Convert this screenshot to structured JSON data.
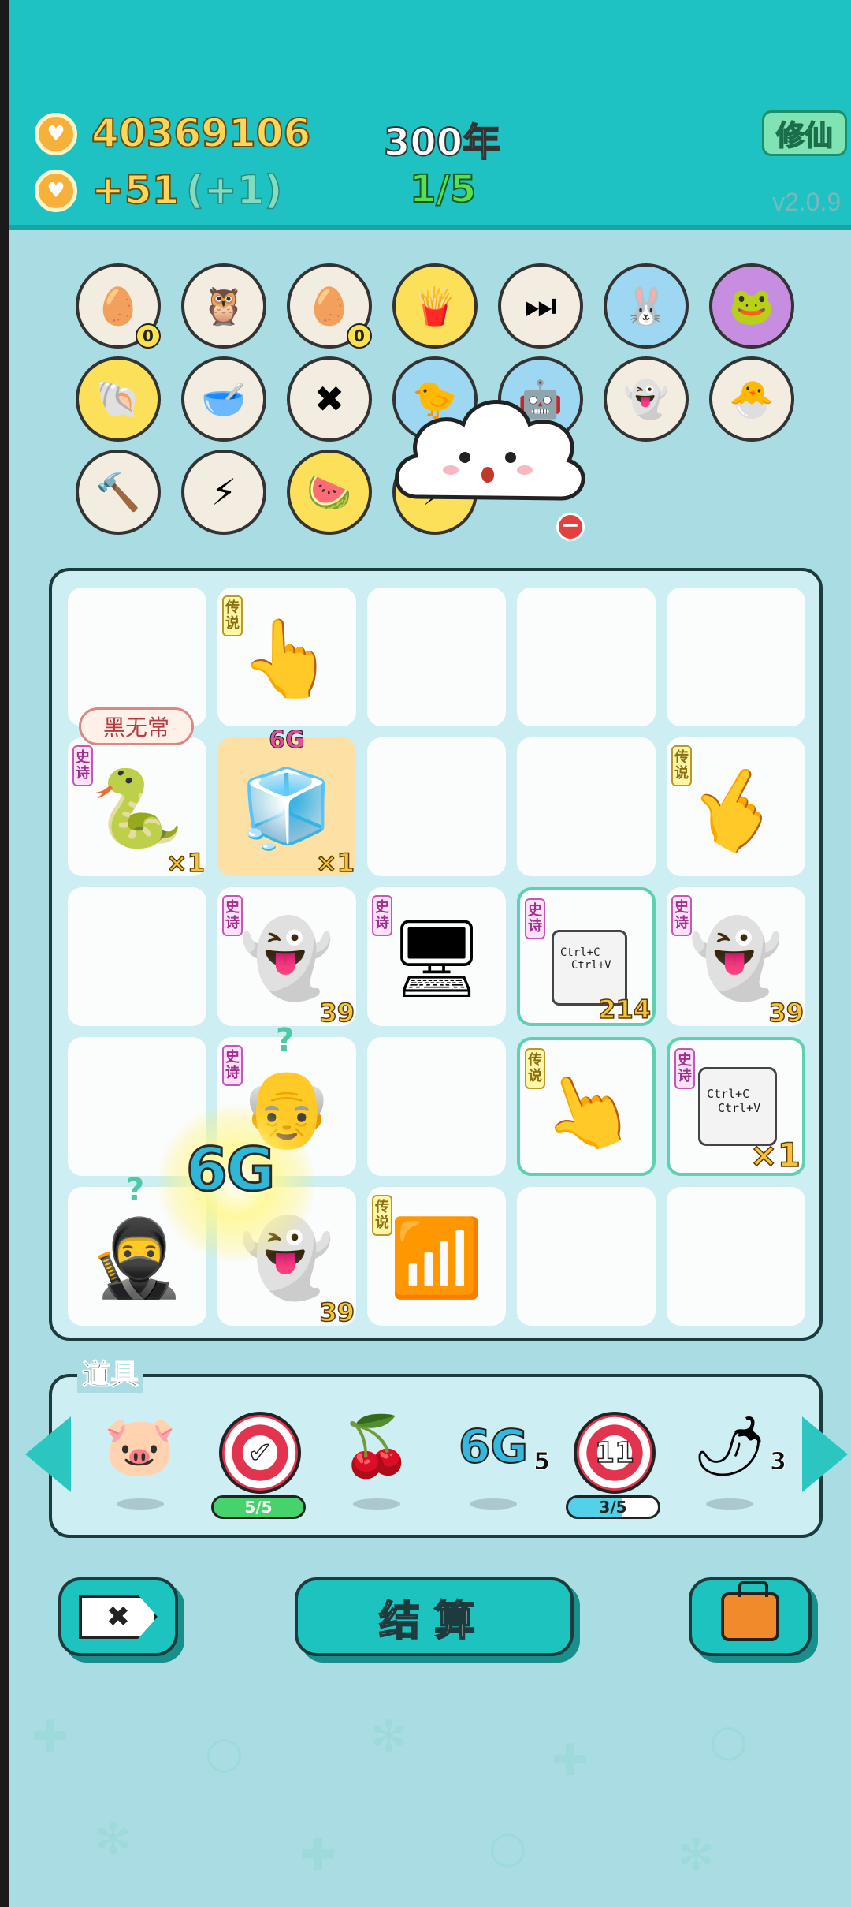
{
  "header": {
    "coins": "40369106",
    "income": "+51",
    "income_bonus": "(+1)",
    "year": "300年",
    "turn": "1/5",
    "xiuxian_button": "修仙",
    "version": "v2.0.9"
  },
  "relics": [
    {
      "icon": "egg-tray-icon",
      "glyph": "🥚",
      "badge": "0"
    },
    {
      "icon": "owl-icon",
      "glyph": "🦉",
      "badge": ""
    },
    {
      "icon": "egg-tray-icon",
      "glyph": "🥚",
      "badge": "0"
    },
    {
      "icon": "fries-icon",
      "glyph": "🍟",
      "badge": ""
    },
    {
      "icon": "skip-icon",
      "glyph": "⏭",
      "badge": ""
    },
    {
      "icon": "rabbit-icon",
      "glyph": "🐰",
      "badge": ""
    },
    {
      "icon": "math-frog-icon",
      "glyph": "🐸",
      "badge": ""
    },
    {
      "icon": "seashell-icon",
      "glyph": "🐚",
      "badge": ""
    },
    {
      "icon": "dog-bowl-icon",
      "glyph": "🥣",
      "badge": ""
    },
    {
      "icon": "delete-tag-icon",
      "glyph": "✖",
      "badge": ""
    },
    {
      "icon": "chick-icon",
      "glyph": "🐤",
      "badge": ""
    },
    {
      "icon": "machine-icon",
      "glyph": "🤖",
      "badge": ""
    },
    {
      "icon": "ghost-icon",
      "glyph": "👻",
      "badge": ""
    },
    {
      "icon": "chick-egg-icon",
      "glyph": "🐣",
      "badge": ""
    },
    {
      "icon": "lightning-hammer-icon",
      "glyph": "🔨",
      "badge": ""
    },
    {
      "icon": "lightning-tag-icon",
      "glyph": "⚡",
      "badge": ""
    },
    {
      "icon": "fruit-bowl-icon",
      "glyph": "🍉",
      "badge": ""
    },
    {
      "icon": "lightning-icon",
      "glyph": "⚡",
      "badge": ""
    }
  ],
  "board": {
    "speech": "黑无常",
    "tags": {
      "legend": "传说",
      "epic": "史诗"
    },
    "counts": {
      "a": "×1",
      "b": "×1",
      "c": "39",
      "d": "214",
      "e": "39",
      "f": "×1",
      "g": "39"
    },
    "cells": {
      "pointer": "👆",
      "snake": "🐍",
      "fridge": "🧊",
      "ghost": "👻",
      "gpu": "🖥",
      "copy_line1": "Ctrl+C",
      "copy_line2": "Ctrl+V",
      "oldman": "👴",
      "thief": "🥷",
      "wifi": "📶"
    },
    "label_6g": "6G",
    "fx_6g": "6G"
  },
  "items": {
    "title": "道具",
    "list": [
      {
        "icon": "piggy-bank-icon",
        "glyph": "🐷"
      },
      {
        "icon": "target-check-icon",
        "glyph": "✔",
        "progress": "5/5"
      },
      {
        "icon": "lychee-icon",
        "glyph": "🍒"
      },
      {
        "icon": "6g-icon",
        "glyph": "6G",
        "count": "5"
      },
      {
        "icon": "target-11-icon",
        "glyph": "11",
        "progress": "3/5"
      },
      {
        "icon": "pepper-icon",
        "glyph": "🌶",
        "count": "3"
      }
    ]
  },
  "buttons": {
    "remove": "✖",
    "settle": "结算",
    "bag": "bag"
  },
  "colors": {
    "header": "#1fc2c2",
    "background": "#a9dde3",
    "accent": "#1dc3bf",
    "gold": "#ffd65a"
  }
}
